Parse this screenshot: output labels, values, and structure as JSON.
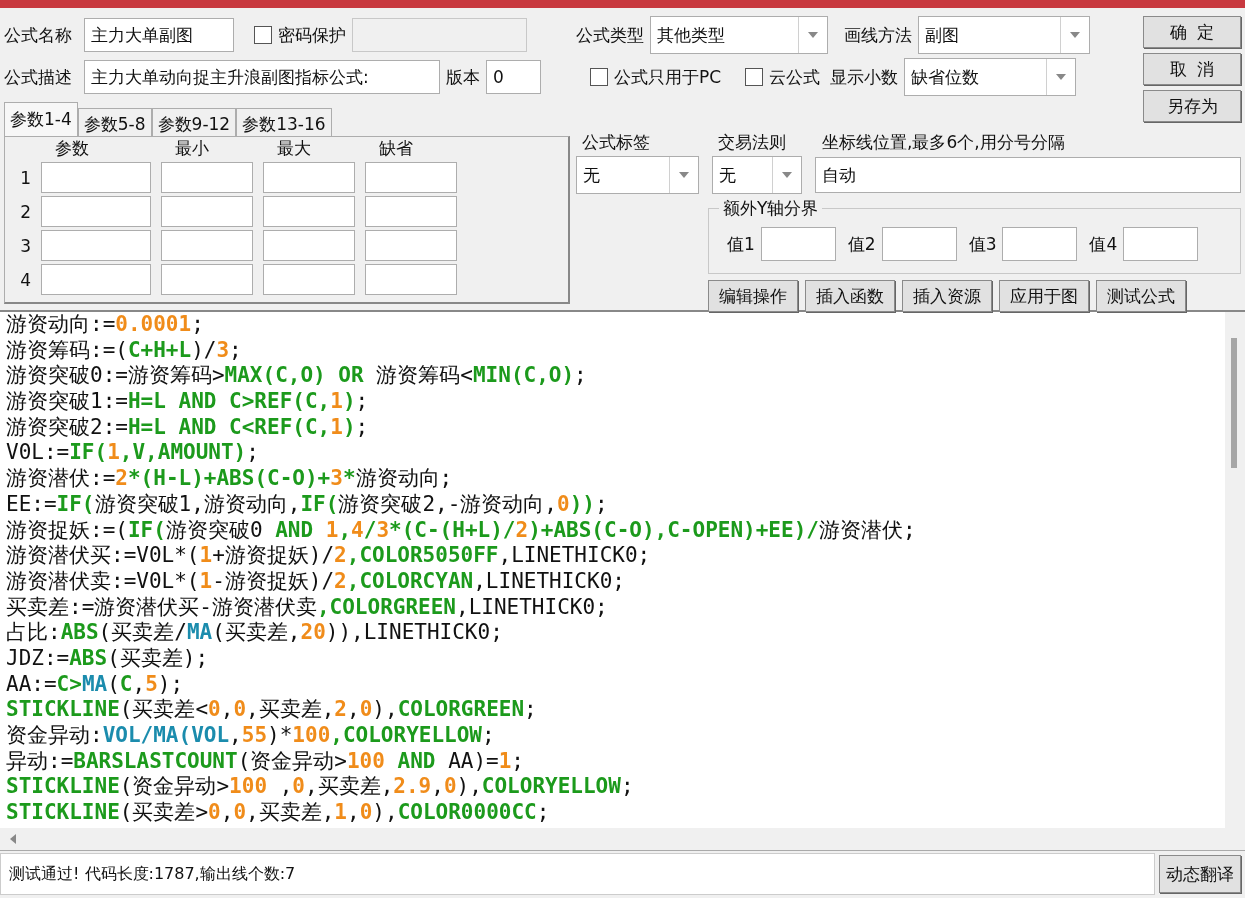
{
  "formula_name": {
    "label": "公式名称",
    "value": "主力大单副图"
  },
  "password": {
    "label": "密码保护",
    "checked": false
  },
  "description": {
    "label": "公式描述",
    "value": "主力大单动向捉主升浪副图指标公式:"
  },
  "version": {
    "label": "版本",
    "value": "0"
  },
  "param_tabs": [
    {
      "label": "参数1-4",
      "selected": true
    },
    {
      "label": "参数5-8",
      "selected": false
    },
    {
      "label": "参数9-12",
      "selected": false
    },
    {
      "label": "参数13-16",
      "selected": false
    }
  ],
  "param_columns": [
    "参数",
    "最小",
    "最大",
    "缺省"
  ],
  "param_rows": [
    "1",
    "2",
    "3",
    "4"
  ],
  "formula_type": {
    "label": "公式类型",
    "value": "其他类型"
  },
  "draw_method": {
    "label": "画线方法",
    "value": "副图"
  },
  "options": [
    {
      "label": "公式只用于PC",
      "checked": false
    },
    {
      "label": "云公式",
      "checked": false
    }
  ],
  "decimals": {
    "label": "显示小数",
    "value": "缺省位数"
  },
  "side_buttons": [
    "确  定",
    "取  消",
    "另存为"
  ],
  "formula_tag": {
    "label": "公式标签",
    "value": "无"
  },
  "trade_rule": {
    "label": "交易法则",
    "value": "无"
  },
  "axis_lines": {
    "label": "坐标线位置,最多6个,用分号分隔",
    "value": "自动"
  },
  "extra_y": {
    "title": "额外Y轴分界",
    "fields": [
      "值1",
      "值2",
      "值3",
      "值4"
    ]
  },
  "action_buttons": [
    "编辑操作",
    "插入函数",
    "插入资源",
    "应用于图",
    "测试公式"
  ],
  "code_lines": [
    {
      "tokens": [
        {
          "kind": "plain",
          "text": "游资动向:="
        },
        {
          "kind": "num",
          "text": "0.0001"
        },
        {
          "kind": "plain",
          "text": ";"
        }
      ]
    },
    {
      "tokens": [
        {
          "kind": "plain",
          "text": "游资筹码:=("
        },
        {
          "kind": "func",
          "text": "C+H+L"
        },
        {
          "kind": "plain",
          "text": ")/"
        },
        {
          "kind": "num",
          "text": "3"
        },
        {
          "kind": "plain",
          "text": ";"
        }
      ]
    },
    {
      "tokens": [
        {
          "kind": "plain",
          "text": "游资突破0:=游资筹码>"
        },
        {
          "kind": "func",
          "text": "MAX(C,O) OR"
        },
        {
          "kind": "plain",
          "text": " 游资筹码<"
        },
        {
          "kind": "func",
          "text": "MIN(C,O)"
        },
        {
          "kind": "plain",
          "text": ";"
        }
      ]
    },
    {
      "tokens": [
        {
          "kind": "plain",
          "text": "游资突破1:="
        },
        {
          "kind": "func",
          "text": "H=L AND C>REF(C,"
        },
        {
          "kind": "num",
          "text": "1"
        },
        {
          "kind": "func",
          "text": ")"
        },
        {
          "kind": "plain",
          "text": ";"
        }
      ]
    },
    {
      "tokens": [
        {
          "kind": "plain",
          "text": "游资突破2:="
        },
        {
          "kind": "func",
          "text": "H=L AND C<REF(C,"
        },
        {
          "kind": "num",
          "text": "1"
        },
        {
          "kind": "func",
          "text": ")"
        },
        {
          "kind": "plain",
          "text": ";"
        }
      ]
    },
    {
      "tokens": [
        {
          "kind": "plain",
          "text": "V0L:="
        },
        {
          "kind": "func",
          "text": "IF("
        },
        {
          "kind": "num",
          "text": "1"
        },
        {
          "kind": "func",
          "text": ",V,AMOUNT)"
        },
        {
          "kind": "plain",
          "text": ";"
        }
      ]
    },
    {
      "tokens": [
        {
          "kind": "plain",
          "text": "游资潜伏:="
        },
        {
          "kind": "num",
          "text": "2"
        },
        {
          "kind": "func",
          "text": "*(H-L)+ABS(C-O)+"
        },
        {
          "kind": "num",
          "text": "3"
        },
        {
          "kind": "func",
          "text": "*"
        },
        {
          "kind": "plain",
          "text": "游资动向;"
        }
      ]
    },
    {
      "tokens": [
        {
          "kind": "plain",
          "text": "EE:="
        },
        {
          "kind": "func",
          "text": "IF("
        },
        {
          "kind": "plain",
          "text": "游资突破1,游资动向,"
        },
        {
          "kind": "func",
          "text": "IF("
        },
        {
          "kind": "plain",
          "text": "游资突破2,-游资动向,"
        },
        {
          "kind": "num",
          "text": "0"
        },
        {
          "kind": "func",
          "text": "))"
        },
        {
          "kind": "plain",
          "text": ";"
        }
      ]
    },
    {
      "tokens": [
        {
          "kind": "plain",
          "text": "游资捉妖:=("
        },
        {
          "kind": "func",
          "text": "IF("
        },
        {
          "kind": "plain",
          "text": "游资突破0 "
        },
        {
          "kind": "func",
          "text": "AND "
        },
        {
          "kind": "num",
          "text": "1"
        },
        {
          "kind": "func",
          "text": ","
        },
        {
          "kind": "num",
          "text": "4"
        },
        {
          "kind": "func",
          "text": "/"
        },
        {
          "kind": "num",
          "text": "3"
        },
        {
          "kind": "func",
          "text": "*(C-(H+L)/"
        },
        {
          "kind": "num",
          "text": "2"
        },
        {
          "kind": "func",
          "text": ")+ABS(C-O),C-OPEN)+EE)/"
        },
        {
          "kind": "plain",
          "text": "游资潜伏;"
        }
      ]
    },
    {
      "tokens": [
        {
          "kind": "plain",
          "text": "游资潜伏买:=V0L*("
        },
        {
          "kind": "num",
          "text": "1"
        },
        {
          "kind": "plain",
          "text": "+游资捉妖)/"
        },
        {
          "kind": "num",
          "text": "2"
        },
        {
          "kind": "func",
          "text": ",COLOR5050FF"
        },
        {
          "kind": "plain",
          "text": ",LINETHICK0;"
        }
      ]
    },
    {
      "tokens": [
        {
          "kind": "plain",
          "text": "游资潜伏卖:=V0L*("
        },
        {
          "kind": "num",
          "text": "1"
        },
        {
          "kind": "plain",
          "text": "-游资捉妖)/"
        },
        {
          "kind": "num",
          "text": "2"
        },
        {
          "kind": "func",
          "text": ",COLORCYAN"
        },
        {
          "kind": "plain",
          "text": ",LINETHICK0;"
        }
      ]
    },
    {
      "tokens": [
        {
          "kind": "plain",
          "text": "买卖差:=游资潜伏买-游资潜伏卖"
        },
        {
          "kind": "func",
          "text": ",COLORGREEN"
        },
        {
          "kind": "plain",
          "text": ",LINETHICK0;"
        }
      ]
    },
    {
      "tokens": [
        {
          "kind": "plain",
          "text": "占比:"
        },
        {
          "kind": "func",
          "text": "ABS"
        },
        {
          "kind": "plain",
          "text": "(买卖差/"
        },
        {
          "kind": "series",
          "text": "MA"
        },
        {
          "kind": "plain",
          "text": "(买卖差,"
        },
        {
          "kind": "num",
          "text": "20"
        },
        {
          "kind": "plain",
          "text": ")),LINETHICK0;"
        }
      ]
    },
    {
      "tokens": [
        {
          "kind": "plain",
          "text": "JDZ:="
        },
        {
          "kind": "func",
          "text": "ABS"
        },
        {
          "kind": "plain",
          "text": "(买卖差);"
        }
      ]
    },
    {
      "tokens": [
        {
          "kind": "plain",
          "text": "AA:="
        },
        {
          "kind": "func",
          "text": "C>"
        },
        {
          "kind": "series",
          "text": "MA"
        },
        {
          "kind": "plain",
          "text": "("
        },
        {
          "kind": "func",
          "text": "C"
        },
        {
          "kind": "plain",
          "text": ","
        },
        {
          "kind": "num",
          "text": "5"
        },
        {
          "kind": "plain",
          "text": ");"
        }
      ]
    },
    {
      "tokens": [
        {
          "kind": "func",
          "text": "STICKLINE"
        },
        {
          "kind": "plain",
          "text": "(买卖差<"
        },
        {
          "kind": "num",
          "text": "0"
        },
        {
          "kind": "plain",
          "text": ","
        },
        {
          "kind": "num",
          "text": "0"
        },
        {
          "kind": "plain",
          "text": ",买卖差,"
        },
        {
          "kind": "num",
          "text": "2"
        },
        {
          "kind": "plain",
          "text": ","
        },
        {
          "kind": "num",
          "text": "0"
        },
        {
          "kind": "plain",
          "text": "),"
        },
        {
          "kind": "func",
          "text": "COLORGREEN"
        },
        {
          "kind": "plain",
          "text": ";"
        }
      ]
    },
    {
      "tokens": [
        {
          "kind": "plain",
          "text": "资金异动:"
        },
        {
          "kind": "series",
          "text": "VOL/MA(VOL"
        },
        {
          "kind": "plain",
          "text": ","
        },
        {
          "kind": "num",
          "text": "55"
        },
        {
          "kind": "plain",
          "text": ")*"
        },
        {
          "kind": "num",
          "text": "100"
        },
        {
          "kind": "func",
          "text": ",COLORYELLOW"
        },
        {
          "kind": "plain",
          "text": ";"
        }
      ]
    },
    {
      "tokens": [
        {
          "kind": "plain",
          "text": "异动:="
        },
        {
          "kind": "func",
          "text": "BARSLASTCOUNT"
        },
        {
          "kind": "plain",
          "text": "(资金异动>"
        },
        {
          "kind": "num",
          "text": "100"
        },
        {
          "kind": "func",
          "text": " AND "
        },
        {
          "kind": "plain",
          "text": "AA)="
        },
        {
          "kind": "num",
          "text": "1"
        },
        {
          "kind": "plain",
          "text": ";"
        }
      ]
    },
    {
      "tokens": [
        {
          "kind": "func",
          "text": "STICKLINE"
        },
        {
          "kind": "plain",
          "text": "(资金异动>"
        },
        {
          "kind": "num",
          "text": "100"
        },
        {
          "kind": "plain",
          "text": " ,"
        },
        {
          "kind": "num",
          "text": "0"
        },
        {
          "kind": "plain",
          "text": ",买卖差,"
        },
        {
          "kind": "num",
          "text": "2.9"
        },
        {
          "kind": "plain",
          "text": ","
        },
        {
          "kind": "num",
          "text": "0"
        },
        {
          "kind": "plain",
          "text": "),"
        },
        {
          "kind": "func",
          "text": "COLORYELLOW"
        },
        {
          "kind": "plain",
          "text": ";"
        }
      ]
    },
    {
      "tokens": [
        {
          "kind": "func",
          "text": "STICKLINE"
        },
        {
          "kind": "plain",
          "text": "(买卖差>"
        },
        {
          "kind": "num",
          "text": "0"
        },
        {
          "kind": "plain",
          "text": ","
        },
        {
          "kind": "num",
          "text": "0"
        },
        {
          "kind": "plain",
          "text": ",买卖差,"
        },
        {
          "kind": "num",
          "text": "1"
        },
        {
          "kind": "plain",
          "text": ","
        },
        {
          "kind": "num",
          "text": "0"
        },
        {
          "kind": "plain",
          "text": "),"
        },
        {
          "kind": "func",
          "text": "COLOR0000CC"
        },
        {
          "kind": "plain",
          "text": ";"
        }
      ]
    }
  ],
  "status": {
    "message": "测试通过! 代码长度:1787,输出线个数:7"
  },
  "translate_button": "动态翻译"
}
